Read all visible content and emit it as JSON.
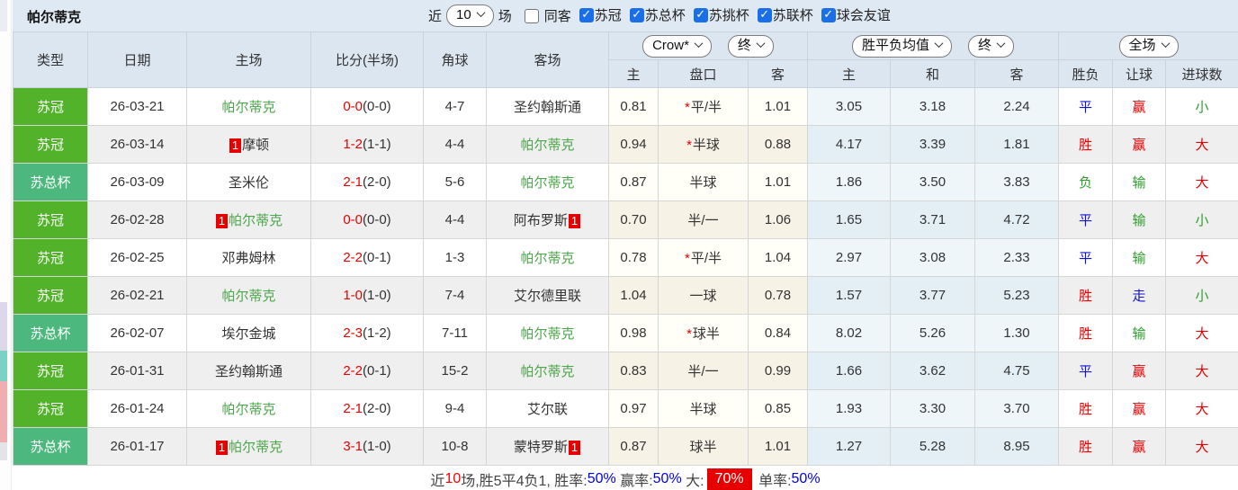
{
  "title": "帕尔蒂克",
  "filters": {
    "near_label": "近",
    "near_value": "10",
    "games_label": "场",
    "same_away": {
      "label": "同客",
      "checked": false
    },
    "leagues": [
      {
        "label": "苏冠",
        "checked": true
      },
      {
        "label": "苏总杯",
        "checked": true
      },
      {
        "label": "苏挑杯",
        "checked": true
      },
      {
        "label": "苏联杯",
        "checked": true
      },
      {
        "label": "球会友谊",
        "checked": true
      }
    ]
  },
  "header": {
    "base_cols": [
      "类型",
      "日期",
      "主场",
      "比分(半场)",
      "角球",
      "客场"
    ],
    "odds_company_dropdown": "Crow*",
    "odds_state_dropdown": "终",
    "odds_cols": [
      "主",
      "盘口",
      "客"
    ],
    "avg_dropdown": "胜平负均值",
    "avg_state_dropdown": "终",
    "avg_cols": [
      "主",
      "和",
      "客"
    ],
    "scope_dropdown": "全场",
    "result_cols": [
      "胜负",
      "让球",
      "进球数"
    ]
  },
  "colors": {
    "league_green": "#52b32b",
    "league_teal": "#4cb87e",
    "team_green": "#4da64d",
    "result_red": "#e60000",
    "result_blue": "#1414cc",
    "result_green": "#2f9e2f",
    "checkbox_blue": "#1a6fe8",
    "footer_highlight_bg": "#e60000"
  },
  "rows": [
    {
      "type": "苏冠",
      "type_style": "lg-green",
      "date": "26-03-21",
      "home": "帕尔蒂克",
      "home_green": true,
      "home_badge": "",
      "score": "0-0",
      "half": "(0-0)",
      "corner": "4-7",
      "away": "圣约翰斯通",
      "away_green": false,
      "away_badge": "",
      "odds_home": "0.81",
      "handicap_star": true,
      "handicap": "平/半",
      "odds_away": "1.01",
      "avg_home": "3.05",
      "avg_draw": "3.18",
      "avg_away": "2.24",
      "result": {
        "text": "平",
        "color": "blue"
      },
      "handicap_result": {
        "text": "赢",
        "color": "red"
      },
      "goals": {
        "text": "小",
        "color": "green"
      }
    },
    {
      "type": "苏冠",
      "type_style": "lg-green",
      "date": "26-03-14",
      "home": "摩顿",
      "home_green": false,
      "home_badge": "1",
      "score": "1-2",
      "half": "(1-1)",
      "corner": "4-4",
      "away": "帕尔蒂克",
      "away_green": true,
      "away_badge": "",
      "odds_home": "0.94",
      "handicap_star": true,
      "handicap": "半球",
      "odds_away": "0.88",
      "avg_home": "4.17",
      "avg_draw": "3.39",
      "avg_away": "1.81",
      "result": {
        "text": "胜",
        "color": "red"
      },
      "handicap_result": {
        "text": "赢",
        "color": "red"
      },
      "goals": {
        "text": "大",
        "color": "red"
      }
    },
    {
      "type": "苏总杯",
      "type_style": "lg-teal",
      "date": "26-03-09",
      "home": "圣米伦",
      "home_green": false,
      "home_badge": "",
      "score": "2-1",
      "half": "(2-0)",
      "corner": "5-6",
      "away": "帕尔蒂克",
      "away_green": true,
      "away_badge": "",
      "odds_home": "0.87",
      "handicap_star": false,
      "handicap": "半球",
      "odds_away": "1.01",
      "avg_home": "1.86",
      "avg_draw": "3.50",
      "avg_away": "3.83",
      "result": {
        "text": "负",
        "color": "green"
      },
      "handicap_result": {
        "text": "输",
        "color": "green"
      },
      "goals": {
        "text": "大",
        "color": "red"
      }
    },
    {
      "type": "苏冠",
      "type_style": "lg-green",
      "date": "26-02-28",
      "home": "帕尔蒂克",
      "home_green": true,
      "home_badge": "1",
      "score": "0-0",
      "half": "(0-0)",
      "corner": "4-4",
      "away": "阿布罗斯",
      "away_green": false,
      "away_badge": "1",
      "odds_home": "0.70",
      "handicap_star": false,
      "handicap": "半/一",
      "odds_away": "1.06",
      "avg_home": "1.65",
      "avg_draw": "3.71",
      "avg_away": "4.72",
      "result": {
        "text": "平",
        "color": "blue"
      },
      "handicap_result": {
        "text": "输",
        "color": "green"
      },
      "goals": {
        "text": "小",
        "color": "green"
      }
    },
    {
      "type": "苏冠",
      "type_style": "lg-green",
      "date": "26-02-25",
      "home": "邓弗姆林",
      "home_green": false,
      "home_badge": "",
      "score": "2-2",
      "half": "(0-1)",
      "corner": "1-3",
      "away": "帕尔蒂克",
      "away_green": true,
      "away_badge": "",
      "odds_home": "0.78",
      "handicap_star": true,
      "handicap": "平/半",
      "odds_away": "1.04",
      "avg_home": "2.97",
      "avg_draw": "3.08",
      "avg_away": "2.33",
      "result": {
        "text": "平",
        "color": "blue"
      },
      "handicap_result": {
        "text": "输",
        "color": "green"
      },
      "goals": {
        "text": "大",
        "color": "red"
      }
    },
    {
      "type": "苏冠",
      "type_style": "lg-green",
      "date": "26-02-21",
      "home": "帕尔蒂克",
      "home_green": true,
      "home_badge": "",
      "score": "1-0",
      "half": "(1-0)",
      "corner": "7-4",
      "away": "艾尔德里联",
      "away_green": false,
      "away_badge": "",
      "odds_home": "1.04",
      "handicap_star": false,
      "handicap": "一球",
      "odds_away": "0.78",
      "avg_home": "1.57",
      "avg_draw": "3.77",
      "avg_away": "5.23",
      "result": {
        "text": "胜",
        "color": "red"
      },
      "handicap_result": {
        "text": "走",
        "color": "blue"
      },
      "goals": {
        "text": "小",
        "color": "green"
      }
    },
    {
      "type": "苏总杯",
      "type_style": "lg-teal",
      "date": "26-02-07",
      "home": "埃尔金城",
      "home_green": false,
      "home_badge": "",
      "score": "2-3",
      "half": "(1-2)",
      "corner": "7-11",
      "away": "帕尔蒂克",
      "away_green": true,
      "away_badge": "",
      "odds_home": "0.98",
      "handicap_star": true,
      "handicap": "球半",
      "odds_away": "0.84",
      "avg_home": "8.02",
      "avg_draw": "5.26",
      "avg_away": "1.30",
      "result": {
        "text": "胜",
        "color": "red"
      },
      "handicap_result": {
        "text": "输",
        "color": "green"
      },
      "goals": {
        "text": "大",
        "color": "red"
      }
    },
    {
      "type": "苏冠",
      "type_style": "lg-green",
      "date": "26-01-31",
      "home": "圣约翰斯通",
      "home_green": false,
      "home_badge": "",
      "score": "2-2",
      "half": "(0-1)",
      "corner": "15-2",
      "away": "帕尔蒂克",
      "away_green": true,
      "away_badge": "",
      "odds_home": "0.83",
      "handicap_star": false,
      "handicap": "半/一",
      "odds_away": "0.99",
      "avg_home": "1.66",
      "avg_draw": "3.62",
      "avg_away": "4.75",
      "result": {
        "text": "平",
        "color": "blue"
      },
      "handicap_result": {
        "text": "赢",
        "color": "red"
      },
      "goals": {
        "text": "大",
        "color": "red"
      }
    },
    {
      "type": "苏冠",
      "type_style": "lg-green",
      "date": "26-01-24",
      "home": "帕尔蒂克",
      "home_green": true,
      "home_badge": "",
      "score": "2-1",
      "half": "(2-0)",
      "corner": "9-4",
      "away": "艾尔联",
      "away_green": false,
      "away_badge": "",
      "odds_home": "0.97",
      "handicap_star": false,
      "handicap": "半球",
      "odds_away": "0.85",
      "avg_home": "1.93",
      "avg_draw": "3.30",
      "avg_away": "3.70",
      "result": {
        "text": "胜",
        "color": "red"
      },
      "handicap_result": {
        "text": "赢",
        "color": "red"
      },
      "goals": {
        "text": "大",
        "color": "red"
      }
    },
    {
      "type": "苏总杯",
      "type_style": "lg-teal",
      "date": "26-01-17",
      "home": "帕尔蒂克",
      "home_green": true,
      "home_badge": "1",
      "score": "3-1",
      "half": "(1-0)",
      "corner": "10-8",
      "away": "蒙特罗斯",
      "away_green": false,
      "away_badge": "1",
      "odds_home": "0.87",
      "handicap_star": false,
      "handicap": "球半",
      "odds_away": "1.01",
      "avg_home": "1.27",
      "avg_draw": "5.28",
      "avg_away": "8.95",
      "result": {
        "text": "胜",
        "color": "red"
      },
      "handicap_result": {
        "text": "赢",
        "color": "red"
      },
      "goals": {
        "text": "大",
        "color": "red"
      }
    }
  ],
  "footer": {
    "segments": [
      {
        "text": "近",
        "style": "dark"
      },
      {
        "text": "10",
        "style": "red"
      },
      {
        "text": "场,胜5平4负1, 胜率:",
        "style": "dark"
      },
      {
        "text": "50%",
        "style": "blue"
      },
      {
        "text": " 赢率:",
        "style": "dark"
      },
      {
        "text": "50%",
        "style": "blue"
      },
      {
        "text": " 大:",
        "style": "dark"
      },
      {
        "text": "70%",
        "style": "redbg"
      },
      {
        "text": " 单率:",
        "style": "dark"
      },
      {
        "text": "50%",
        "style": "blue"
      }
    ]
  }
}
